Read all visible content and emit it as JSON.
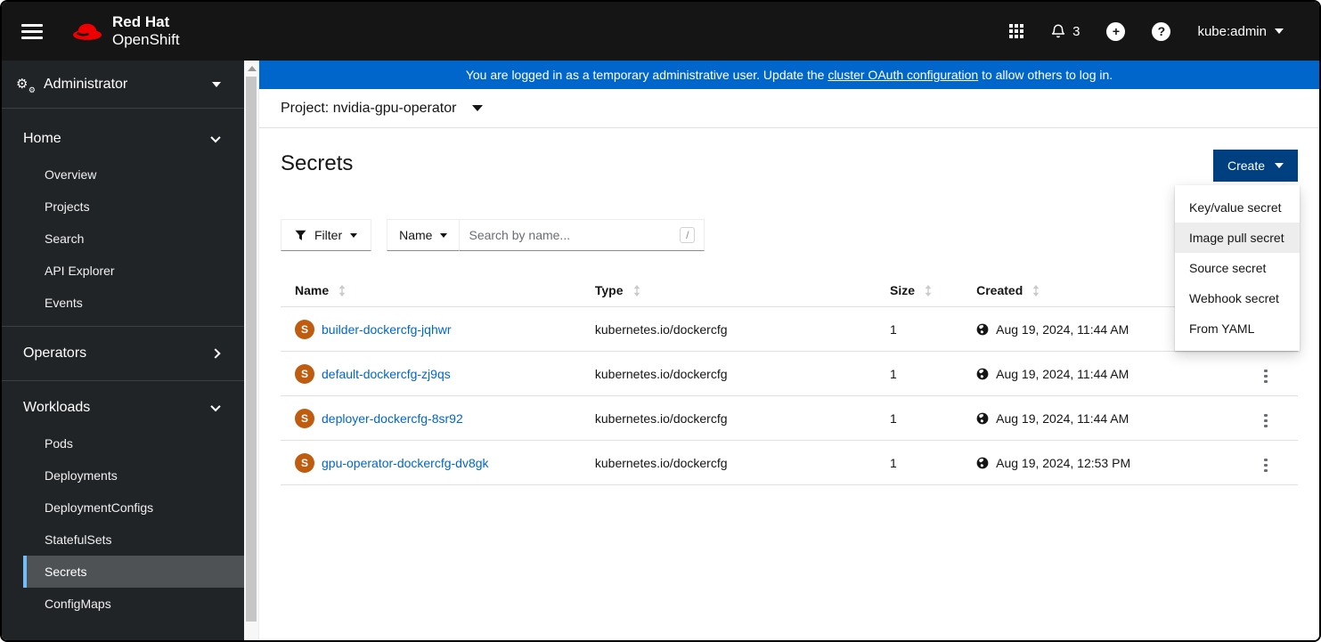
{
  "masthead": {
    "brand": {
      "line1": "Red Hat",
      "line2": "OpenShift"
    },
    "notification_count": "3",
    "user": "kube:admin"
  },
  "banner": {
    "prefix": "You are logged in as a temporary administrative user. Update the ",
    "link": "cluster OAuth configuration",
    "suffix": " to allow others to log in."
  },
  "project_bar": {
    "label": "Project:",
    "value": "nvidia-gpu-operator"
  },
  "sidebar": {
    "perspective": "Administrator",
    "home": {
      "label": "Home",
      "items": [
        "Overview",
        "Projects",
        "Search",
        "API Explorer",
        "Events"
      ]
    },
    "operators": {
      "label": "Operators"
    },
    "workloads": {
      "label": "Workloads",
      "items": [
        "Pods",
        "Deployments",
        "DeploymentConfigs",
        "StatefulSets",
        "Secrets",
        "ConfigMaps"
      ],
      "selected": "Secrets"
    }
  },
  "page": {
    "title": "Secrets"
  },
  "create": {
    "label": "Create",
    "menu": [
      "Key/value secret",
      "Image pull secret",
      "Source secret",
      "Webhook secret",
      "From YAML"
    ],
    "highlighted": "Image pull secret"
  },
  "toolbar": {
    "filter": "Filter",
    "attribute": "Name",
    "search_placeholder": "Search by name...",
    "shortcut": "/"
  },
  "table": {
    "headers": [
      "Name",
      "Type",
      "Size",
      "Created"
    ],
    "rows": [
      {
        "badge": "S",
        "name": "builder-dockercfg-jqhwr",
        "type": "kubernetes.io/dockercfg",
        "size": "1",
        "created": "Aug 19, 2024, 11:44 AM"
      },
      {
        "badge": "S",
        "name": "default-dockercfg-zj9qs",
        "type": "kubernetes.io/dockercfg",
        "size": "1",
        "created": "Aug 19, 2024, 11:44 AM"
      },
      {
        "badge": "S",
        "name": "deployer-dockercfg-8sr92",
        "type": "kubernetes.io/dockercfg",
        "size": "1",
        "created": "Aug 19, 2024, 11:44 AM"
      },
      {
        "badge": "S",
        "name": "gpu-operator-dockercfg-dv8gk",
        "type": "kubernetes.io/dockercfg",
        "size": "1",
        "created": "Aug 19, 2024, 12:53 PM"
      }
    ]
  },
  "icons": {
    "hamburger-icon": "three-bars",
    "redhat-fedora-icon": "red-fedora",
    "app-launcher-icon": "3x3-grid",
    "bell-icon": "bell-outline",
    "plus-circle-icon": "+",
    "help-icon": "?",
    "caret-down-icon": "filled-triangle-down",
    "cogs-icon": "two-gears",
    "chevron-down-icon": "angle-down",
    "chevron-right-icon": "angle-right",
    "filter-icon": "funnel",
    "sort-icon": "double-arrow-vertical",
    "globe-icon": "globe-americas",
    "kebab-icon": "vertical-dots",
    "secret-badge": "S"
  },
  "colors": {
    "banner_blue": "#0066cc",
    "create_button_blue": "#004080",
    "link_blue": "#0066cc",
    "secret_badge_orange": "#c05c10",
    "nav_selected_bg": "#4f5255",
    "nav_active_indicator": "#73bcf7",
    "masthead_bg": "#151515",
    "sidebar_bg": "#212427"
  }
}
